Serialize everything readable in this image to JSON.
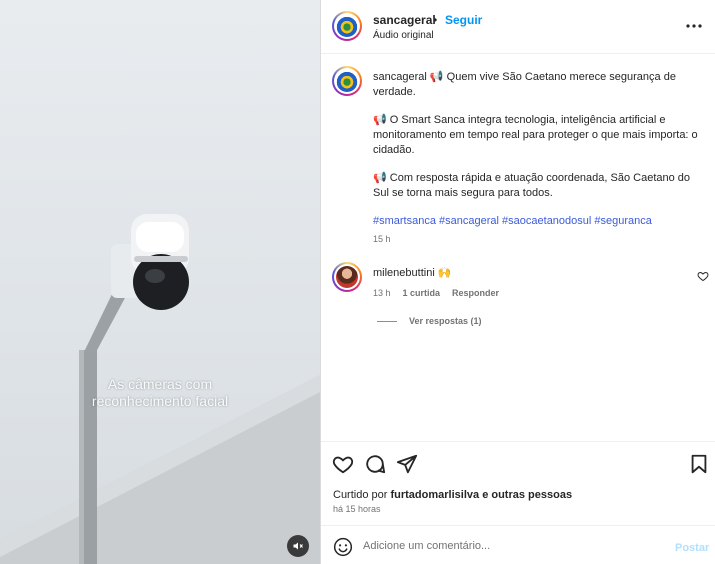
{
  "media": {
    "caption_line1": "As câmeras com",
    "caption_line2": "reconhecimento facial",
    "mute_icon": "speaker-muted-icon"
  },
  "header": {
    "username": "sancageral",
    "separator": "•",
    "follow_label": "Seguir",
    "audio_label": "Áudio original",
    "more_icon": "more-horizontal-icon"
  },
  "post": {
    "username": "sancageral",
    "megaphone": "📢",
    "paragraph1": "Quem vive São Caetano merece segurança de verdade.",
    "paragraph2": "O Smart Sanca integra tecnologia, inteligência artificial e monitoramento em tempo real para proteger o que mais importa: o cidadão.",
    "paragraph3": "Com resposta rápida e atuação coordenada, São Caetano do Sul se torna mais segura para todos.",
    "hashtags": [
      "#smartsanca",
      "#sancageral",
      "#saocaetanodosul",
      "#seguranca"
    ],
    "time_ago": "15 h"
  },
  "comment": {
    "username": "milenebuttini",
    "text": "🙌",
    "time": "13 h",
    "likes": "1 curtida",
    "reply_label": "Responder",
    "view_replies": "Ver respostas (1)"
  },
  "actions": {
    "liked_prefix": "Curtido por",
    "liked_user": "furtadomarlisilva",
    "liked_suffix": "e outras pessoas",
    "posted_time": "há 15 horas"
  },
  "composer": {
    "placeholder": "Adicione um comentário...",
    "post_label": "Postar"
  },
  "colors": {
    "accent": "#0095f6",
    "hashtag": "#3b5bdb",
    "muted": "#737373"
  }
}
